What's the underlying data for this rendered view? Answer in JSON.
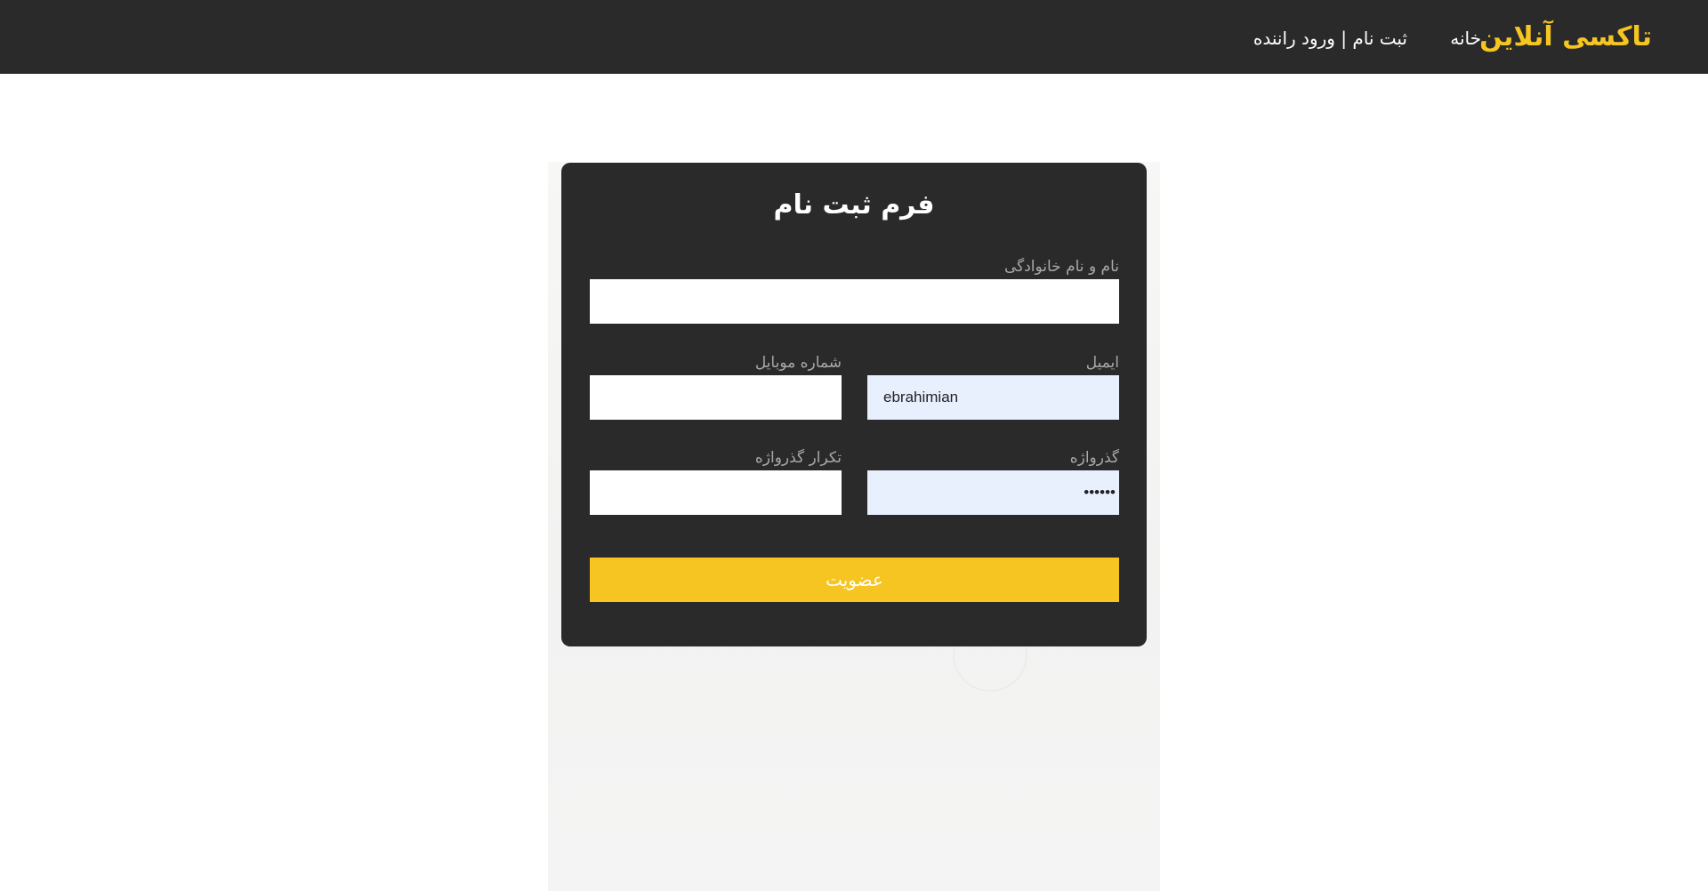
{
  "navbar": {
    "brand": "تاکسی آنلاین",
    "links": [
      {
        "label": "خانه"
      },
      {
        "label": "ثبت نام | ورود راننده"
      }
    ]
  },
  "form": {
    "title": "فرم ثبت نام",
    "fields": {
      "fullname": {
        "label": "نام و نام خانوادگی",
        "value": ""
      },
      "email": {
        "label": "ایمیل",
        "value": "ebrahimian"
      },
      "mobile": {
        "label": "شماره موبایل",
        "value": ""
      },
      "password": {
        "label": "گذرواژه",
        "value": "••••••"
      },
      "password_repeat": {
        "label": "تکرار گذرواژه",
        "value": ""
      }
    },
    "submit_label": "عضویت"
  },
  "colors": {
    "navbar_bg": "#2a2a2a",
    "brand": "#f6c522",
    "card_bg": "#2a2a2a",
    "button_bg": "#f6c522",
    "autofill_bg": "#e8f0fe",
    "label": "#a8a8a8"
  }
}
